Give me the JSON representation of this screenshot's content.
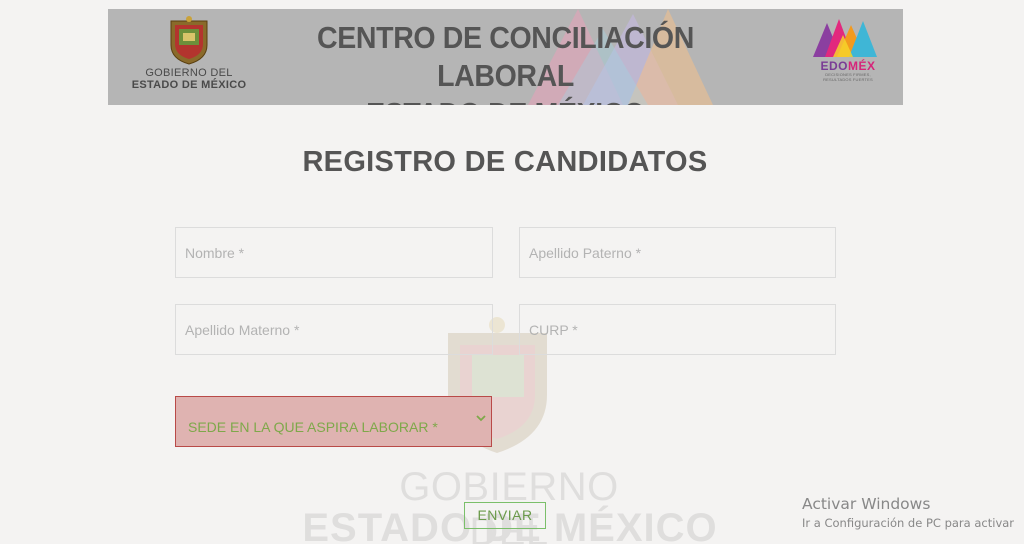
{
  "header": {
    "gov_logo": {
      "line1": "GOBIERNO DEL",
      "line2": "ESTADO DE MÉXICO"
    },
    "title_line1": "CENTRO DE CONCILIACIÓN LABORAL",
    "title_line2": "ESTADO DE MÉXICO",
    "edomex_logo": {
      "brand_edo": "EDO",
      "brand_mex": "MÉX",
      "tagline_line1": "DECISIONES FIRMES,",
      "tagline_line2": "RESULTADOS FUERTES"
    }
  },
  "form": {
    "title": "REGISTRO DE CANDIDATOS",
    "fields": {
      "nombre": {
        "placeholder": "Nombre *",
        "value": ""
      },
      "apellido_paterno": {
        "placeholder": "Apellido Paterno *",
        "value": ""
      },
      "apellido_materno": {
        "placeholder": "Apellido Materno *",
        "value": ""
      },
      "curp": {
        "placeholder": "CURP *",
        "value": ""
      }
    },
    "sede_select": {
      "selected": "SEDE EN LA QUE ASPIRA LABORAR *",
      "state": "invalid"
    },
    "submit_label": "ENVIAR"
  },
  "watermark": {
    "line1": "GOBIERNO DEL",
    "line2": "ESTADO DE MÉXICO"
  },
  "windows_activation": {
    "title": "Activar Windows",
    "subtitle": "Ir a Configuración de PC para activar"
  },
  "colors": {
    "page_background": "#f4f3f2",
    "banner_background": "#b5b5b5",
    "title_text": "#555555",
    "invalid_border": "#b94a48",
    "invalid_fill": "#dfb3b1",
    "select_text": "#7ea84a",
    "submit_border": "#7bbf6a"
  },
  "icons": {
    "select_chevron": "chevron-down-icon",
    "gov_shield": "coat-of-arms-icon",
    "edomex": "edomex-mountains-icon"
  }
}
